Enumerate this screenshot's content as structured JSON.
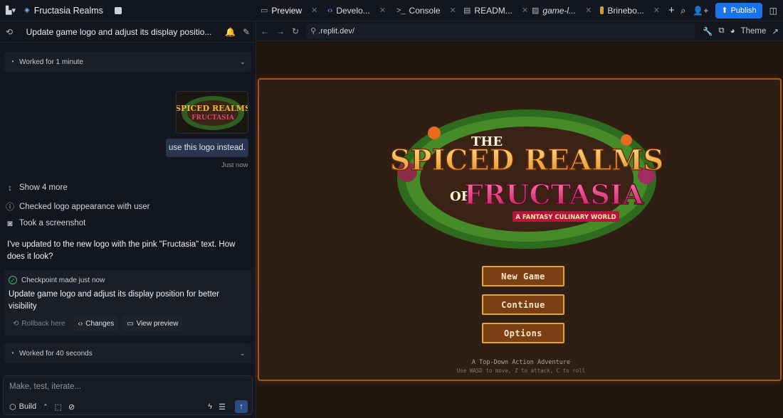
{
  "topbar": {
    "project_name": "Fructasia Realms",
    "tabs": [
      {
        "label": "Preview",
        "icon": "monitor-icon"
      },
      {
        "label": "Develo...",
        "icon": "code-icon"
      },
      {
        "label": "Console",
        "icon": "terminal-icon"
      },
      {
        "label": "READM...",
        "icon": "file-icon"
      },
      {
        "label": "game-l...",
        "icon": "image-icon"
      },
      {
        "label": "Brinebo...",
        "icon": "js-file-icon"
      }
    ],
    "publish_label": "Publish"
  },
  "chat": {
    "title": "Update game logo and adjust its display positio...",
    "worked_1": "Worked for 1 minute",
    "user_message": "use this logo instead.",
    "user_message_time": "Just now",
    "show_more": "Show 4 more",
    "actions": [
      "Checked logo appearance with user",
      "Took a screenshot"
    ],
    "agent_message": "I've updated to the new logo with the pink \"Fructasia\" text. How does it look?",
    "checkpoint": {
      "status": "Checkpoint made just now",
      "description": "Update game logo and adjust its display position for better visibility",
      "rollback_label": "Rollback here",
      "changes_label": "Changes",
      "view_preview_label": "View preview"
    },
    "worked_2": "Worked for 40 seconds",
    "input_placeholder": "Make, test, iterate...",
    "build_label": "Build"
  },
  "preview": {
    "url": ".replit.dev/",
    "theme_label": "Theme",
    "game": {
      "logo_line1": "THE",
      "logo_line2": "SPICED REALMS",
      "logo_line3": "OF",
      "logo_line4": "FRUCTASIA",
      "logo_ribbon": "A FANTASY CULINARY WORLD",
      "buttons": [
        "New Game",
        "Continue",
        "Options"
      ],
      "subtitle": "A Top-Down Action Adventure",
      "controls_hint": "Use WASD to move, Z to attack, C to roll"
    }
  }
}
